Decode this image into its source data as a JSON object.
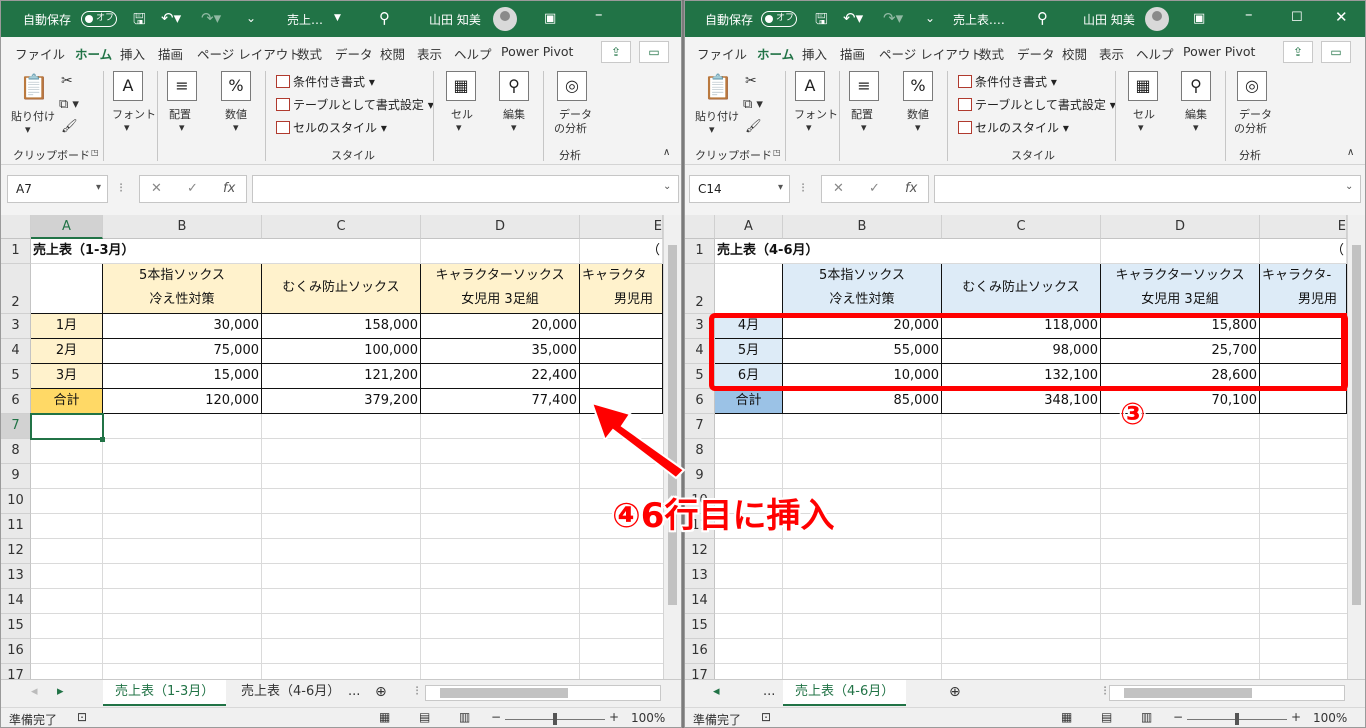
{
  "left": {
    "autosave_label": "自動保存",
    "autosave_state": "オフ",
    "file_title": "売上…",
    "user_name": "山田 知美",
    "name_box": "A7",
    "sheet_active": "売上表（1-3月）",
    "sheet_other": "売上表（4-6月）",
    "sheet_more": "...",
    "table_title": "売上表（1-3月）",
    "title_overflow": "（",
    "col_e_header": "E",
    "col_e_text": "キャラクタ",
    "col_e_text2": "男児用",
    "header_b1": "5本指ソックス",
    "header_b2": "冷え性対策",
    "header_c": "むくみ防止ソックス",
    "header_d1": "キャラクターソックス",
    "header_d2": "女児用 3足組",
    "rows": [
      {
        "label": "1月",
        "b": "30,000",
        "c": "158,000",
        "d": "20,000"
      },
      {
        "label": "2月",
        "b": "75,000",
        "c": "100,000",
        "d": "35,000"
      },
      {
        "label": "3月",
        "b": "15,000",
        "c": "121,200",
        "d": "22,400"
      },
      {
        "label": "合計",
        "b": "120,000",
        "c": "379,200",
        "d": "77,400"
      }
    ]
  },
  "right": {
    "autosave_label": "自動保存",
    "autosave_state": "オフ",
    "file_title": "売上表.…",
    "user_name": "山田 知美",
    "name_box": "C14",
    "sheet_active": "売上表（4-6月）",
    "sheet_more": "...",
    "table_title": "売上表（4-6月）",
    "title_overflow": "（",
    "col_e_header": "E",
    "col_e_text": "キャラクタ-",
    "col_e_text2": "男児用",
    "header_b1": "5本指ソックス",
    "header_b2": "冷え性対策",
    "header_c": "むくみ防止ソックス",
    "header_d1": "キャラクターソックス",
    "header_d2": "女児用 3足組",
    "rows": [
      {
        "label": "4月",
        "b": "20,000",
        "c": "118,000",
        "d": "15,800"
      },
      {
        "label": "5月",
        "b": "55,000",
        "c": "98,000",
        "d": "25,700"
      },
      {
        "label": "6月",
        "b": "10,000",
        "c": "132,100",
        "d": "28,600"
      },
      {
        "label": "合計",
        "b": "85,000",
        "c": "348,100",
        "d": "70,100"
      }
    ]
  },
  "menu": [
    "ファイル",
    "ホーム",
    "挿入",
    "描画",
    "ページ レイアウト",
    "数式",
    "データ",
    "校閲",
    "表示",
    "ヘルプ",
    "Power Pivot"
  ],
  "ribbon": {
    "paste": "貼り付け",
    "clipboard": "クリップボード",
    "font": "フォント",
    "align": "配置",
    "number": "数値",
    "cond_format": "条件付き書式",
    "table_format": "テーブルとして書式設定",
    "cell_style": "セルのスタイル",
    "style_group": "スタイル",
    "cells": "セル",
    "edit": "編集",
    "analyze1": "データ",
    "analyze2": "の分析",
    "analyze_group": "分析"
  },
  "columns": [
    "A",
    "B",
    "C",
    "D"
  ],
  "row_numbers": [
    "1",
    "2",
    "3",
    "4",
    "5",
    "6",
    "7",
    "8",
    "9",
    "10",
    "11",
    "12",
    "13",
    "14",
    "15",
    "16",
    "17"
  ],
  "status": {
    "ready": "準備完了",
    "zoom": "100%"
  },
  "annotations": {
    "step3": "③",
    "step4": "④6行目に挿入"
  },
  "colors": {
    "excel_green": "#217346",
    "annotation_red": "#ff0000",
    "header_fill_left": "#fff2cc",
    "total_fill_left": "#ffd966",
    "header_fill_right": "#ddebf7",
    "total_fill_right": "#9bc2e6"
  }
}
